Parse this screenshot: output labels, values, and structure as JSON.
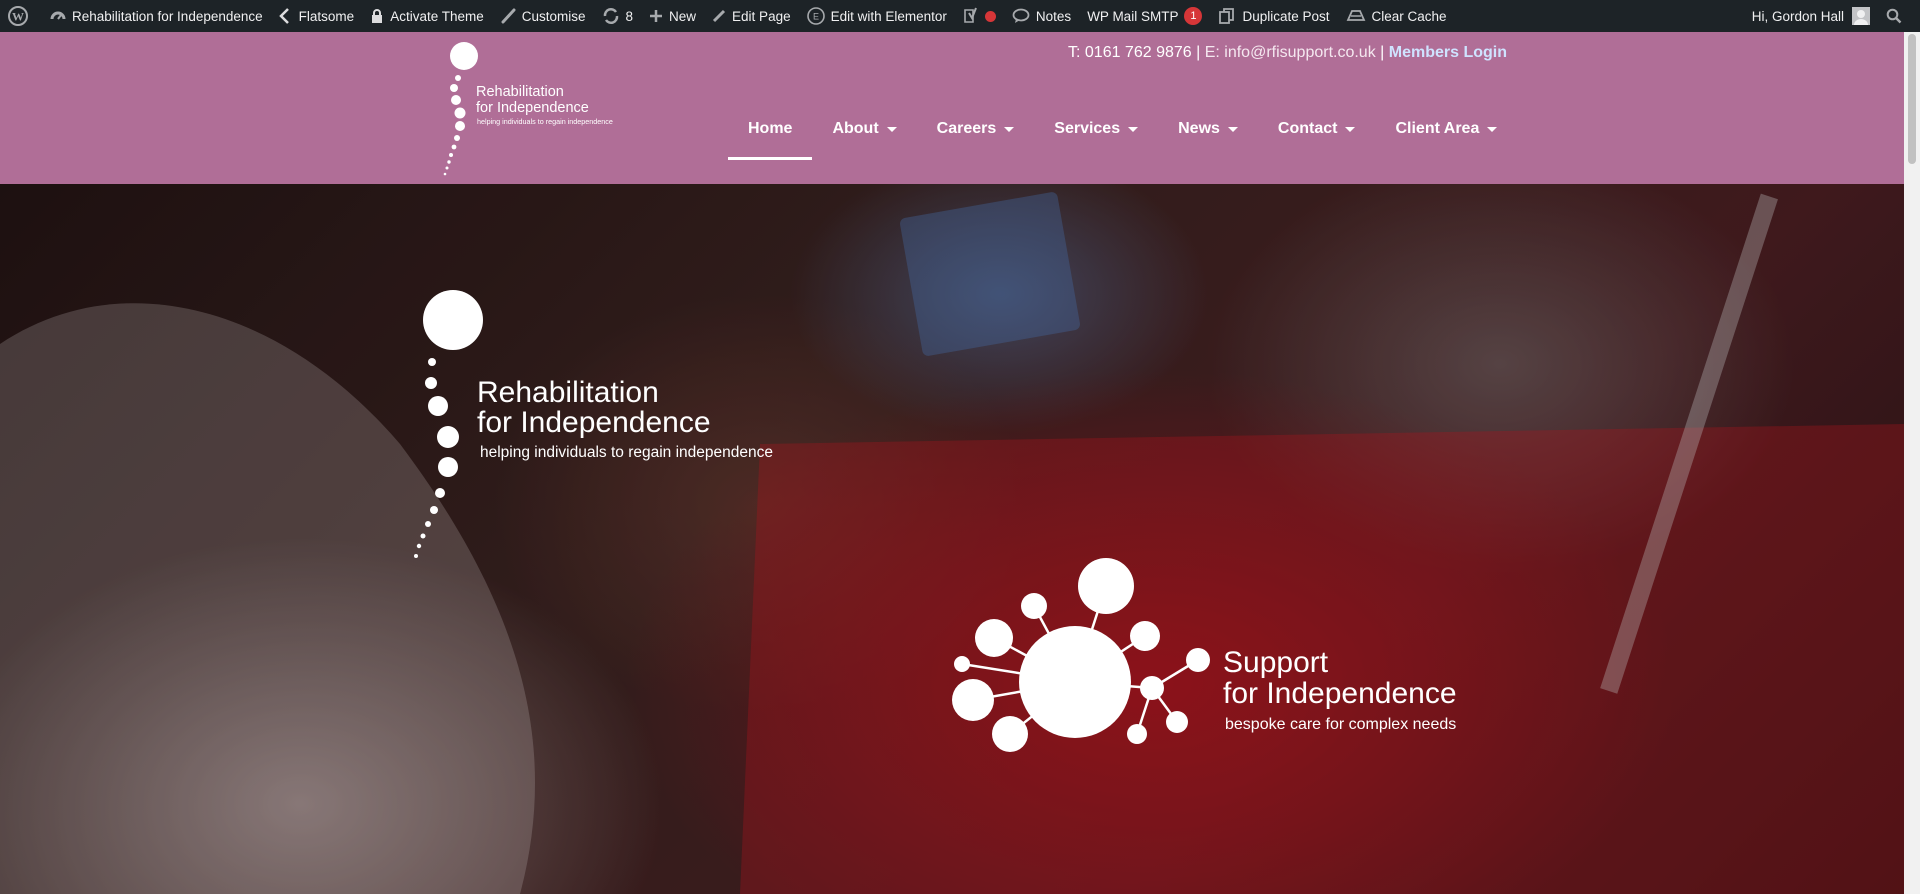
{
  "adminbar": {
    "site_name": "Rehabilitation for Independence",
    "theme": "Flatsome",
    "activate_theme": "Activate Theme",
    "customise": "Customise",
    "updates_count": "8",
    "new": "New",
    "edit_page": "Edit Page",
    "edit_elementor": "Edit with Elementor",
    "notes": "Notes",
    "wp_mail_smtp": "WP Mail SMTP",
    "wp_mail_smtp_badge": "1",
    "duplicate_post": "Duplicate Post",
    "clear_cache": "Clear Cache",
    "greeting": "Hi, Gordon Hall"
  },
  "header": {
    "phone": "T: 0161 762 9876 |",
    "email": "E: info@rfisupport.co.uk",
    "separator": "|",
    "members_login": "Members Login",
    "logo_line1": "Rehabilitation",
    "logo_line2": "for Independence",
    "logo_tagline": "helping individuals to regain independence"
  },
  "nav": {
    "items": [
      {
        "label": "Home",
        "active": true
      },
      {
        "label": "About"
      },
      {
        "label": "Careers"
      },
      {
        "label": "Services"
      },
      {
        "label": "News"
      },
      {
        "label": "Contact"
      },
      {
        "label": "Client Area"
      }
    ]
  },
  "hero": {
    "rfi_line1": "Rehabilitation",
    "rfi_line2": "for Independence",
    "rfi_tagline": "helping individuals to regain independence",
    "sfi_line1": "Support",
    "sfi_line2": "for Independence",
    "sfi_tagline": "bespoke care for complex needs"
  },
  "colors": {
    "header_bg": "#b06e97",
    "adminbar_bg": "#1d2327",
    "members_login": "#cfe3ff"
  }
}
